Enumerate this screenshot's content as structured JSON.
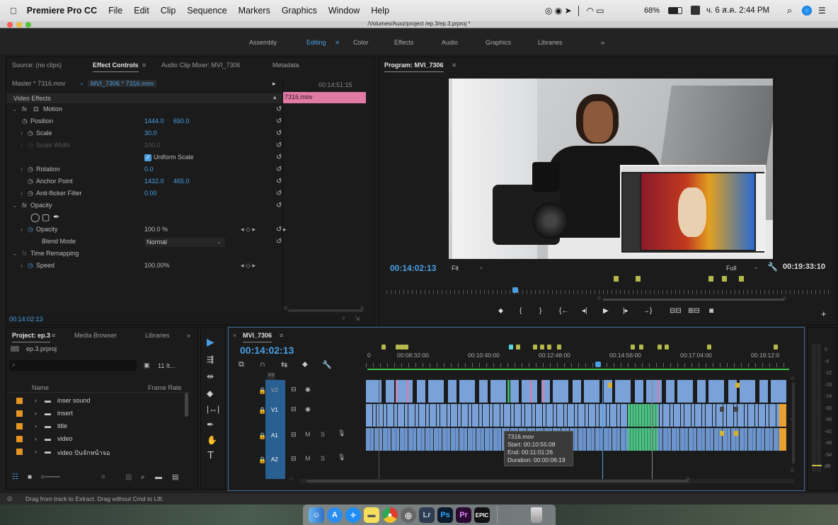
{
  "menubar": {
    "app": "Premiere Pro CC",
    "menus": [
      "File",
      "Edit",
      "Clip",
      "Sequence",
      "Markers",
      "Graphics",
      "Window",
      "Help"
    ],
    "battery": "68%",
    "datetime": "ч. 6 ส.ค. 2:44 PM"
  },
  "window": {
    "path": "/Volumes/Auxz/project /ep.3/ep.3.prproj *"
  },
  "workspaces": [
    "Assembly",
    "Editing",
    "Color",
    "Effects",
    "Audio",
    "Graphics",
    "Libraries",
    "»"
  ],
  "source_panel": {
    "tabs": [
      "Source: (no clips)",
      "Effect Controls",
      "Audio Clip Mixer: MVI_7306",
      "Metadata"
    ],
    "master": "Master * 7316.mov",
    "seq_clip": "MVI_7306 * 7316.mov",
    "timecode": "00:14:51:15",
    "clip_label": "7316.mov",
    "video_effects": "Video Effects",
    "rows": [
      {
        "name": "Motion",
        "v1": "",
        "v2": ""
      },
      {
        "name": "Position",
        "v1": "1444.0",
        "v2": "650.0"
      },
      {
        "name": "Scale",
        "v1": "30.0",
        "v2": ""
      },
      {
        "name": "Scale Width",
        "v1": "100.0",
        "v2": ""
      },
      {
        "name": "Uniform Scale",
        "v1": "",
        "v2": ""
      },
      {
        "name": "Rotation",
        "v1": "0.0",
        "v2": ""
      },
      {
        "name": "Anchor Point",
        "v1": "1432.0",
        "v2": "465.0"
      },
      {
        "name": "Anti-flicker Filter",
        "v1": "0.00",
        "v2": ""
      },
      {
        "name": "Opacity",
        "v1": "",
        "v2": ""
      },
      {
        "name": "Opacity",
        "v1": "100.0 %",
        "v2": ""
      },
      {
        "name": "Blend Mode",
        "v1": "Normal",
        "v2": ""
      },
      {
        "name": "Time Remapping",
        "v1": "",
        "v2": ""
      },
      {
        "name": "Speed",
        "v1": "100.00%",
        "v2": ""
      }
    ],
    "current_time": "00:14:02:13"
  },
  "program_panel": {
    "title": "Program: MVI_7306",
    "timecode": "00:14:02:13",
    "fit": "Fit",
    "quality": "Full",
    "duration": "00:19:33:10"
  },
  "project_panel": {
    "tabs": [
      "Project: ep.3",
      "Media Browser",
      "Libraries",
      "»"
    ],
    "file": "ep.3.prproj",
    "count": "11 It...",
    "col_name": "Name",
    "col_rate": "Frame Rate",
    "items": [
      "inser sound",
      "insert",
      "title",
      "video",
      "video ปันจักหน้าจอ"
    ]
  },
  "timeline": {
    "tab": "MVI_7306",
    "timecode": "00:14:02:13",
    "ruler": [
      "0",
      "00:08:32:00",
      "00:10:40:00",
      "00:12:48:00",
      "00:14:56:00",
      "00:17:04:00",
      "00:19:12:0"
    ],
    "tracks": [
      "V3",
      "V2",
      "V1",
      "A1",
      "A2"
    ],
    "tooltip": {
      "name": "7316.mov",
      "start": "Start: 00:10:55:08",
      "end": "End: 00:11:01:26",
      "duration": "Duration: 00:00:06:19"
    },
    "meter": [
      "0",
      "-6",
      "-12",
      "-18",
      "-24",
      "-30",
      "-36",
      "-42",
      "-48",
      "-54",
      "dB"
    ]
  },
  "status": {
    "hint": "Drag from track to Extract. Drag without Cmd to Lift."
  },
  "dock": [
    "Finder",
    "App Store",
    "Safari",
    "Notes",
    "Chrome",
    "Screen",
    "Lr",
    "Ps",
    "Pr",
    "EPIC",
    "Trash"
  ],
  "colors": {
    "accent": "#4a9fe3",
    "clip_pink": "#e27aa6",
    "video_clip": "#7aa2d9",
    "marker": "#b5b84a"
  }
}
